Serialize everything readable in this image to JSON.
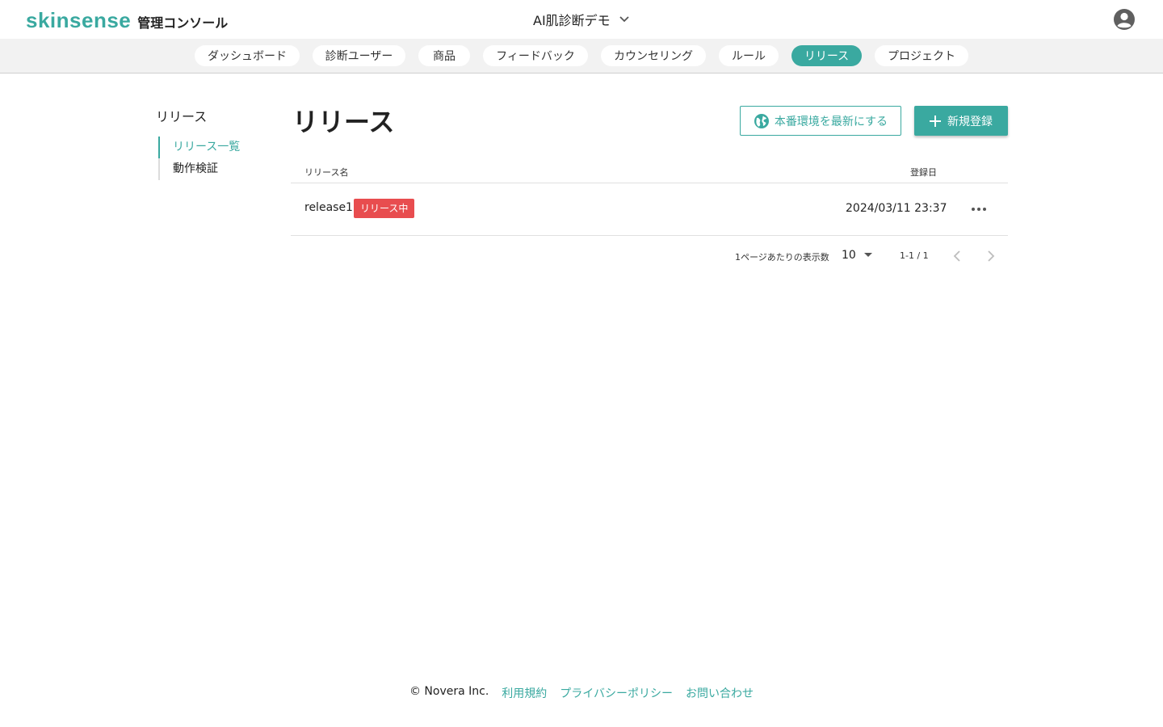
{
  "colors": {
    "accent": "#3aa9a0",
    "badge_red": "#e84d4f",
    "inactive_arrow": "#bdbdbd"
  },
  "header": {
    "brand": "skinsense",
    "brand_sub": "管理コンソール",
    "project": "AI肌診断デモ",
    "project_icon": "chevron-down-icon",
    "avatar_icon": "account-circle-icon"
  },
  "tabs": [
    "ダッシュボード",
    "診断ユーザー",
    "商品",
    "フィードバック",
    "カウンセリング",
    "ルール",
    "リリース",
    "プロジェクト"
  ],
  "active_tab": "リリース",
  "sidebar": {
    "title": "リリース",
    "items": [
      "リリース一覧",
      "動作検証"
    ],
    "active": "リリース一覧"
  },
  "main": {
    "title": "リリース",
    "btn_update": "本番環境を最新にする",
    "btn_update_icon": "globe-icon",
    "btn_new": "新規登録",
    "btn_new_icon": "plus-icon",
    "columns": {
      "name": "リリース名",
      "date": "登録日"
    },
    "rows": [
      {
        "name": "release1",
        "badge": "リリース中",
        "date": "2024/03/11 23:37",
        "action_icon": "more-horizontal-icon"
      }
    ]
  },
  "pagination": {
    "per_page_label": "1ページあたりの表示数",
    "per_page": "10",
    "range": "1-1 / 1",
    "prev_icon": "chevron-left-icon",
    "next_icon": "chevron-right-icon"
  },
  "footer": {
    "copyright": "© Novera Inc.",
    "links": [
      "利用規約",
      "プライバシーポリシー",
      "お問い合わせ"
    ]
  }
}
